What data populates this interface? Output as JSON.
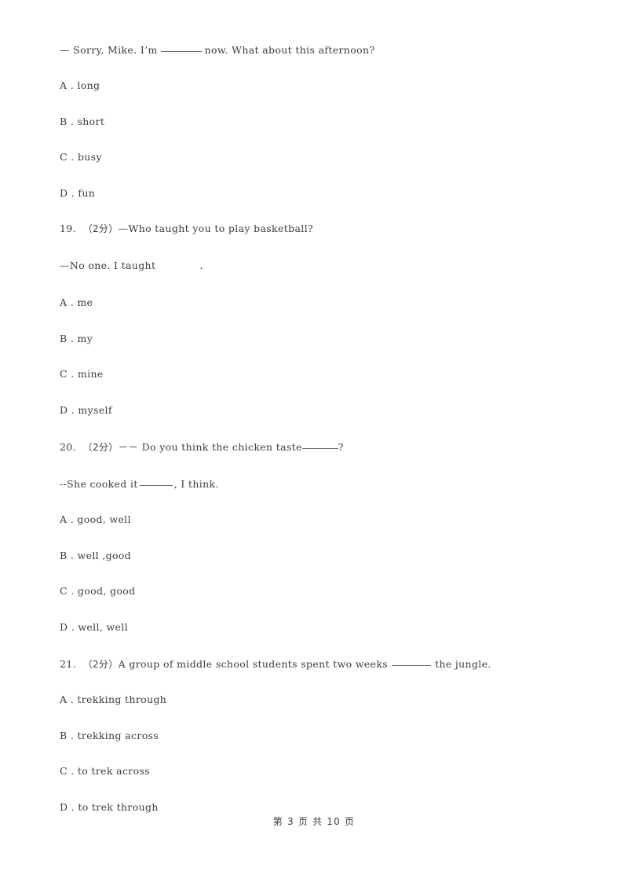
{
  "document": {
    "type": "exam-paper",
    "language": "en-zh",
    "page_number": 3,
    "total_pages": 10,
    "footer_text": "第 3 页 共 10 页"
  },
  "blocks": [
    {
      "kind": "question-continuation",
      "stem_text": "— Sorry, Mike. I’m",
      "stem_text_after": "now. What about this afternoon?",
      "options": [
        {
          "label": "A .",
          "text": "long"
        },
        {
          "label": "B .",
          "text": "short"
        },
        {
          "label": "C .",
          "text": "busy"
        },
        {
          "label": "D .",
          "text": "fun"
        }
      ]
    },
    {
      "kind": "question",
      "number": "19.",
      "marks": "（2分）",
      "stem_text": "—Who taught you to play basketball?",
      "stem_line2_before": "—No one. I taught",
      "stem_line2_after": ".",
      "options": [
        {
          "label": "A .",
          "text": "me"
        },
        {
          "label": "B .",
          "text": "my"
        },
        {
          "label": "C .",
          "text": "mine"
        },
        {
          "label": "D .",
          "text": "myself"
        }
      ]
    },
    {
      "kind": "question",
      "number": "20.",
      "marks": "（2分）",
      "stem_prefix": "－－",
      "stem_text": "Do you think the chicken taste",
      "stem_text_after": "?",
      "stem_line2_before": "--She cooked it",
      "stem_line2_after": ", I think.",
      "options": [
        {
          "label": "A .",
          "text": "good, well"
        },
        {
          "label": "B .",
          "text": "well ,good"
        },
        {
          "label": "C .",
          "text": "good, good"
        },
        {
          "label": "D .",
          "text": "well, well"
        }
      ]
    },
    {
      "kind": "question",
      "number": "21.",
      "marks": "（2分）",
      "stem_text": "A group of middle school students spent two weeks",
      "stem_text_after": "the jungle.",
      "options": [
        {
          "label": "A .",
          "text": "trekking through"
        },
        {
          "label": "B .",
          "text": "trekking across"
        },
        {
          "label": "C .",
          "text": "to trek across"
        },
        {
          "label": "D .",
          "text": "to trek through"
        }
      ]
    }
  ]
}
